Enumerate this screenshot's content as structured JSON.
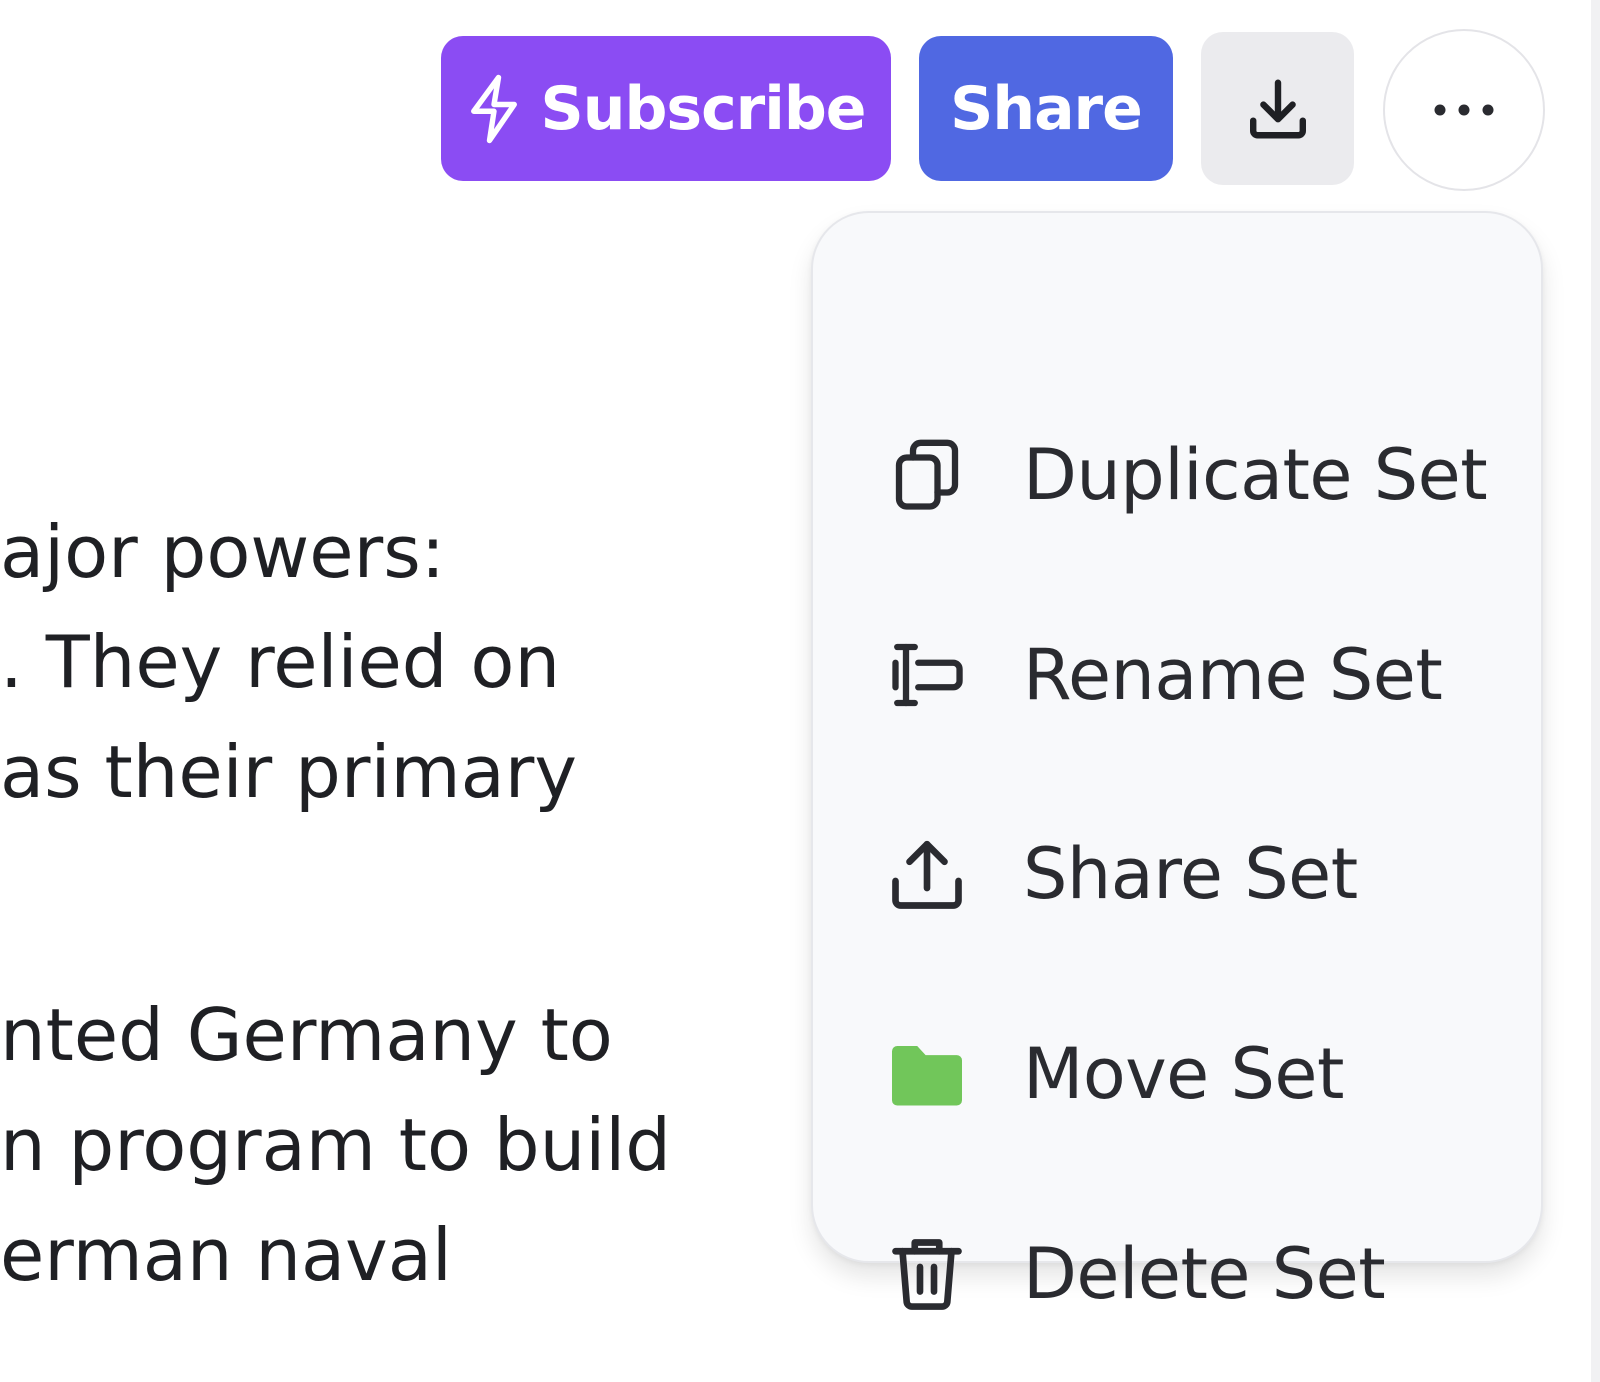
{
  "toolbar": {
    "subscribe_label": "Subscribe",
    "subscribe_icon": "lightning-bolt-icon",
    "share_label": "Share",
    "download_icon": "download-icon",
    "more_icon": "more-horizontal-icon",
    "colors": {
      "subscribe_bg": "#8b4cf3",
      "share_bg": "#5068e2",
      "download_bg": "#ebebee"
    }
  },
  "content": {
    "paragraph_1": [
      "ajor powers:",
      ". They relied on",
      "as their primary"
    ],
    "paragraph_2": [
      "nted Germany to",
      "n program to build",
      "erman naval"
    ]
  },
  "menu": {
    "items": [
      {
        "label": "Duplicate Set",
        "icon": "duplicate-icon"
      },
      {
        "label": "Rename Set",
        "icon": "rename-icon"
      },
      {
        "label": "Share Set",
        "icon": "share-upload-icon"
      },
      {
        "label": "Move Set",
        "icon": "folder-icon",
        "icon_color": "#71c65a"
      },
      {
        "label": "Delete Set",
        "icon": "trash-icon"
      }
    ]
  }
}
